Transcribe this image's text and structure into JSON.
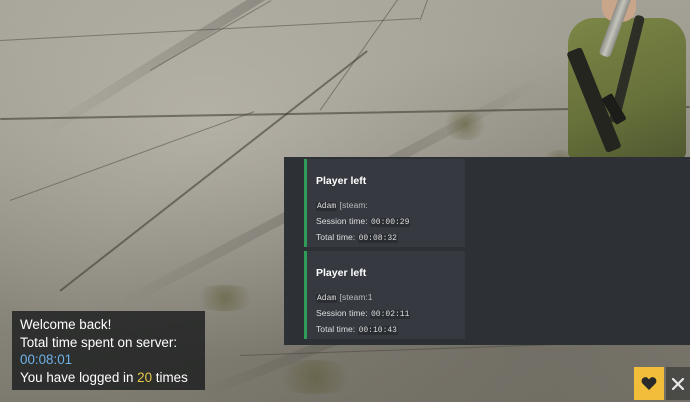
{
  "welcome": {
    "greeting": "Welcome back!",
    "total_time_label": "Total time spent on server:",
    "total_time_value": "00:08:01",
    "logged_prefix": "You have logged in ",
    "logged_count": "20",
    "logged_suffix": " times"
  },
  "notifications": [
    {
      "title": "Player left",
      "player": "Adam",
      "identifier": "[steam:",
      "session_label": "Session time:",
      "session_value": "00:00:29",
      "total_label": "Total time:",
      "total_value": "00:08:32"
    },
    {
      "title": "Player left",
      "player": "Adam",
      "identifier": "[steam:1",
      "session_label": "Session time:",
      "session_value": "00:02:11",
      "total_label": "Total time:",
      "total_value": "00:10:43"
    }
  ],
  "icons": {
    "heart_button": "heart-icon",
    "close_button": "close-icon"
  },
  "colors": {
    "accent_green": "#2f9d58",
    "time_blue": "#6fb0e8",
    "count_yellow": "#e8c84a",
    "heart_button_bg": "#f2bd3a"
  }
}
